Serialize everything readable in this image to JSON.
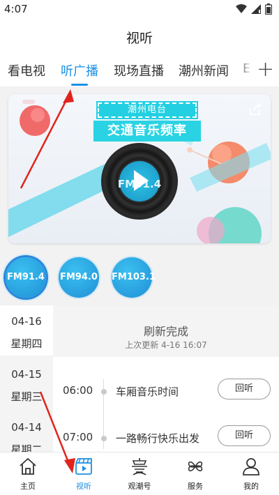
{
  "status_bar": {
    "time": "4:07"
  },
  "header": {
    "title": "视听"
  },
  "tabs": [
    {
      "label": "看电视"
    },
    {
      "label": "听广播",
      "active": true
    },
    {
      "label": "现场直播"
    },
    {
      "label": "潮州新闻"
    },
    {
      "label": "E"
    }
  ],
  "banner": {
    "tag": "潮州电台",
    "title": "交通音乐频率",
    "disc_label": "FM91.4"
  },
  "frequencies": [
    {
      "label": "FM91.4",
      "selected": true
    },
    {
      "label": "FM94.0"
    },
    {
      "label": "FM103.1"
    }
  ],
  "dates": [
    {
      "day": "04-16",
      "weekday": "星期四",
      "active": true
    },
    {
      "day": "04-15",
      "weekday": "星期三"
    },
    {
      "day": "04-14",
      "weekday": "星期二"
    }
  ],
  "refresh": {
    "title": "刷新完成",
    "subtitle": "上次更新 4-16 16:07"
  },
  "programs": [
    {
      "time": "06:00",
      "name": "车厢音乐时间",
      "action": "回听"
    },
    {
      "time": "07:00",
      "name": "一路畅行快乐出发",
      "action": "回听"
    }
  ],
  "bottom_nav": [
    {
      "label": "主页",
      "icon": "home-icon"
    },
    {
      "label": "视听",
      "icon": "video-icon",
      "active": true
    },
    {
      "label": "观潮号",
      "icon": "tide-icon"
    },
    {
      "label": "服务",
      "icon": "services-icon"
    },
    {
      "label": "我的",
      "icon": "profile-icon"
    }
  ],
  "colors": {
    "accent": "#1a8fe3",
    "annotation": "#e0241c"
  }
}
